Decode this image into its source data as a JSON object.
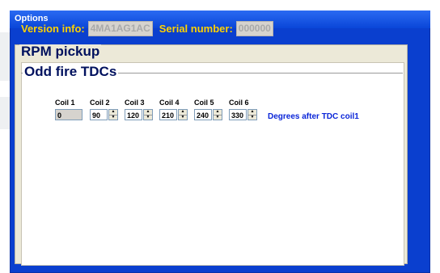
{
  "window": {
    "title": "Options"
  },
  "info": {
    "version_label": "Version info:",
    "version_value": "4MA1AG1AC",
    "serial_label": "Serial number:",
    "serial_value": "000000"
  },
  "groups": {
    "outer_title": "RPM pickup",
    "inner_title": "Odd fire TDCs"
  },
  "coils": [
    {
      "label": "Coil 1",
      "value": "0",
      "readonly": true
    },
    {
      "label": "Coil 2",
      "value": "90"
    },
    {
      "label": "Coil 3",
      "value": "120"
    },
    {
      "label": "Coil 4",
      "value": "210"
    },
    {
      "label": "Coil 5",
      "value": "240"
    },
    {
      "label": "Coil 6",
      "value": "330"
    }
  ],
  "degrees_note": "Degrees after TDC coil1",
  "icons": {
    "up": "spinner-up-icon",
    "down": "spinner-down-icon"
  }
}
